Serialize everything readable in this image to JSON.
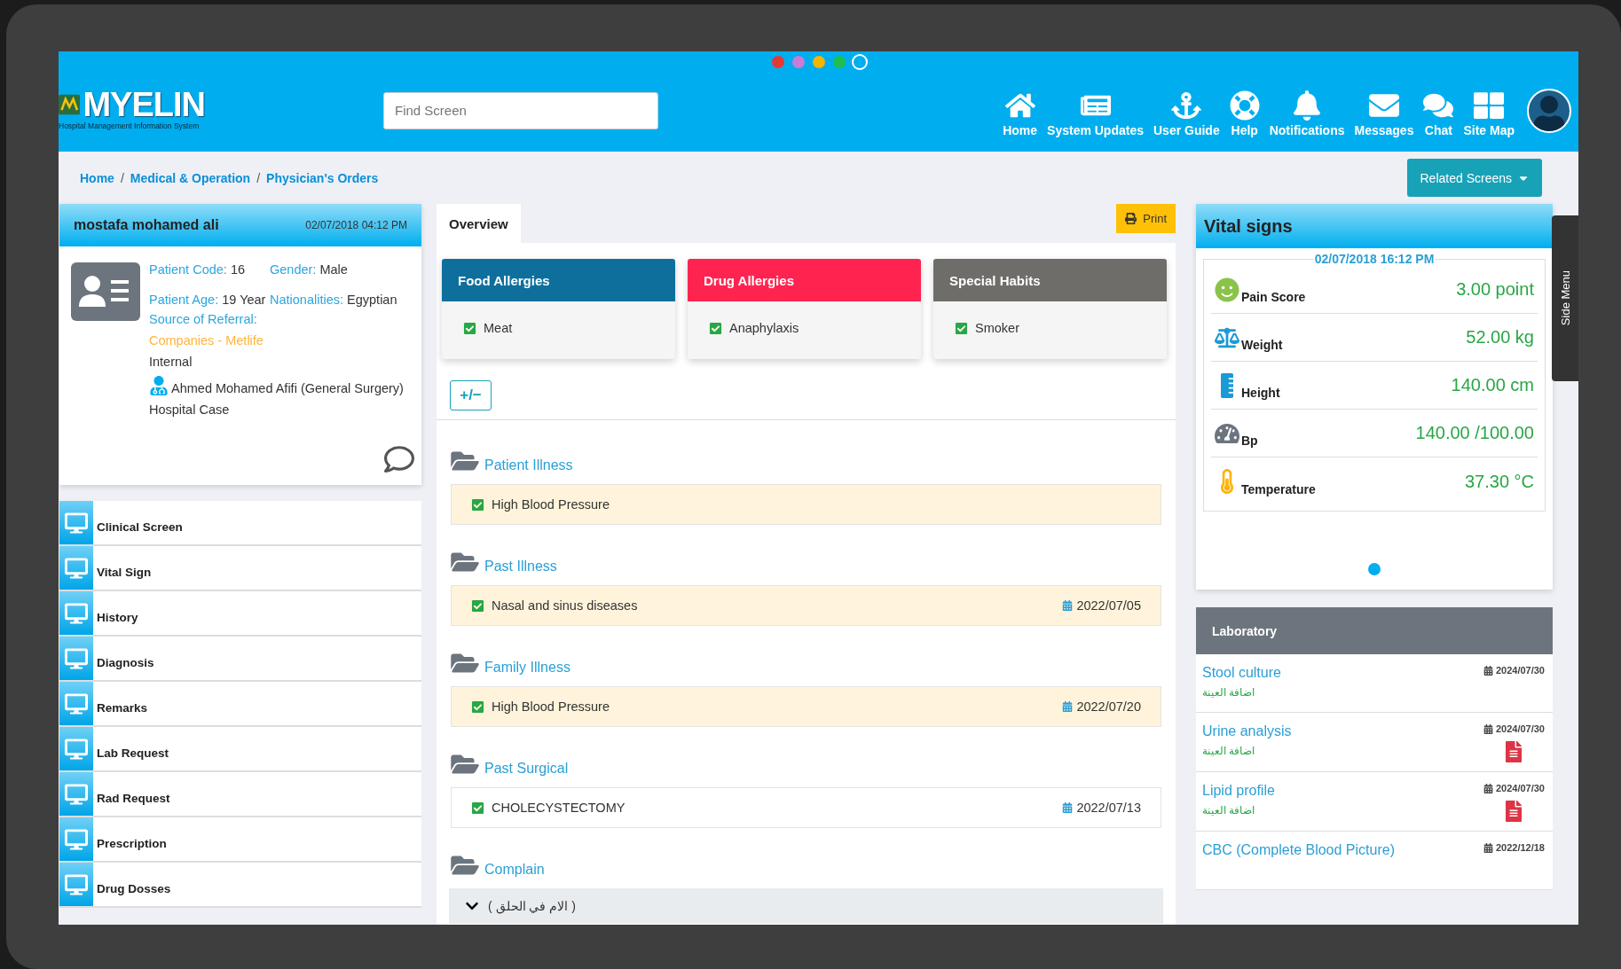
{
  "theme_dots": [
    {
      "color": "#e53935",
      "selected": false
    },
    {
      "color": "#c77dd6",
      "selected": false
    },
    {
      "color": "#f4b400",
      "selected": false
    },
    {
      "color": "#1fbf4f",
      "selected": false
    },
    {
      "color": "#00aeef",
      "selected": true
    }
  ],
  "logo": {
    "title": "MYELIN",
    "subtitle": "Hospital Management Information System"
  },
  "search": {
    "placeholder": "Find Screen"
  },
  "nav": [
    {
      "label": "Home"
    },
    {
      "label": "System Updates"
    },
    {
      "label": "User Guide"
    },
    {
      "label": "Help"
    },
    {
      "label": "Notifications"
    },
    {
      "label": "Messages"
    },
    {
      "label": "Chat"
    },
    {
      "label": "Site Map"
    }
  ],
  "breadcrumb": [
    {
      "kind": "link",
      "text": "Home"
    },
    {
      "kind": "separator",
      "text": "/"
    },
    {
      "kind": "link",
      "text": "Medical & Operation"
    },
    {
      "kind": "separator",
      "text": "/"
    },
    {
      "kind": "link",
      "text": "Physician's Orders"
    }
  ],
  "related_button": {
    "label": "Related Screens"
  },
  "patient": {
    "name": "mostafa mohamed ali",
    "datetime": "02/07/2018 04:12 PM",
    "fields": [
      {
        "label": "Patient Code:",
        "value": "16"
      },
      {
        "label": "Gender:",
        "value": "Male"
      },
      {
        "label": "Patient Age:",
        "value": "19 Year"
      },
      {
        "label": "Nationalities:",
        "value": "Egyptian"
      }
    ],
    "referral_label": "Source of Referral:",
    "referral": "Companies - Metlife",
    "referral_type": "Internal",
    "doctor": "Ahmed Mohamed Afifi (General Surgery)",
    "case": "Hospital Case"
  },
  "sidebar": {
    "items": [
      "Clinical Screen",
      "Vital Sign",
      "History",
      "Diagnosis",
      "Remarks",
      "Lab Request",
      "Rad Request",
      "Prescription",
      "Drug Dosses"
    ]
  },
  "overview": {
    "tabs": [
      {
        "label": "Overview",
        "selected": true
      }
    ],
    "print": {
      "label": "Print"
    },
    "cards": [
      {
        "title": "Food Allergies",
        "color": "#0f6f9c",
        "items": [
          {
            "text": "Meat",
            "checked": true
          }
        ]
      },
      {
        "title": "Drug Allergies",
        "color": "#ff2450",
        "items": [
          {
            "text": "Anaphylaxis",
            "checked": true
          }
        ]
      },
      {
        "title": "Special Habits",
        "color": "#6e6d69",
        "items": [
          {
            "text": "Smoker",
            "checked": true
          }
        ]
      }
    ],
    "toggle": {
      "label": "+/−"
    },
    "sections": [
      {
        "title": "Patient Illness",
        "items": [
          {
            "text": "High Blood Pressure",
            "checked": true,
            "highlighted": true
          }
        ]
      },
      {
        "title": "Past Illness",
        "items": [
          {
            "text": "Nasal and sinus diseases",
            "checked": true,
            "date": "2022/07/05",
            "highlighted": true
          }
        ]
      },
      {
        "title": "Family Illness",
        "items": [
          {
            "text": "High Blood Pressure",
            "checked": true,
            "date": "2022/07/20",
            "highlighted": true
          }
        ]
      },
      {
        "title": "Past Surgical",
        "items": [
          {
            "text": "CHOLECYSTECTOMY",
            "checked": true,
            "date": "2022/07/13",
            "highlighted": false
          }
        ]
      },
      {
        "title": "Complain",
        "accordion": [
          {
            "label": "( الام في الحلق )",
            "expanded": false
          }
        ]
      }
    ]
  },
  "vital_signs": {
    "title": "Vital signs",
    "datetime": "02/07/2018 16:12 PM",
    "rows": [
      {
        "label": "Pain Score",
        "value": "3.00 point"
      },
      {
        "label": "Weight",
        "value": "52.00 kg"
      },
      {
        "label": "Height",
        "value": "140.00 cm"
      },
      {
        "label": "Bp",
        "value": "140.00 /100.00"
      },
      {
        "label": "Temperature",
        "value": "37.30 °C"
      }
    ],
    "pages": [
      {
        "selected": true
      }
    ]
  },
  "laboratory": {
    "title": "Laboratory",
    "items": [
      {
        "name": "Stool culture",
        "status": "اضافة العينة",
        "date": "2024/07/30",
        "report": false
      },
      {
        "name": "Urine analysis",
        "status": "اضافة العينة",
        "date": "2024/07/30",
        "report": true
      },
      {
        "name": "Lipid profile",
        "status": "اضافة العينة",
        "date": "2024/07/30",
        "report": true
      },
      {
        "name": "CBC (Complete Blood Picture)",
        "date": "2022/12/18",
        "report": false
      }
    ]
  },
  "side_menu": {
    "label": "Side Menu"
  }
}
